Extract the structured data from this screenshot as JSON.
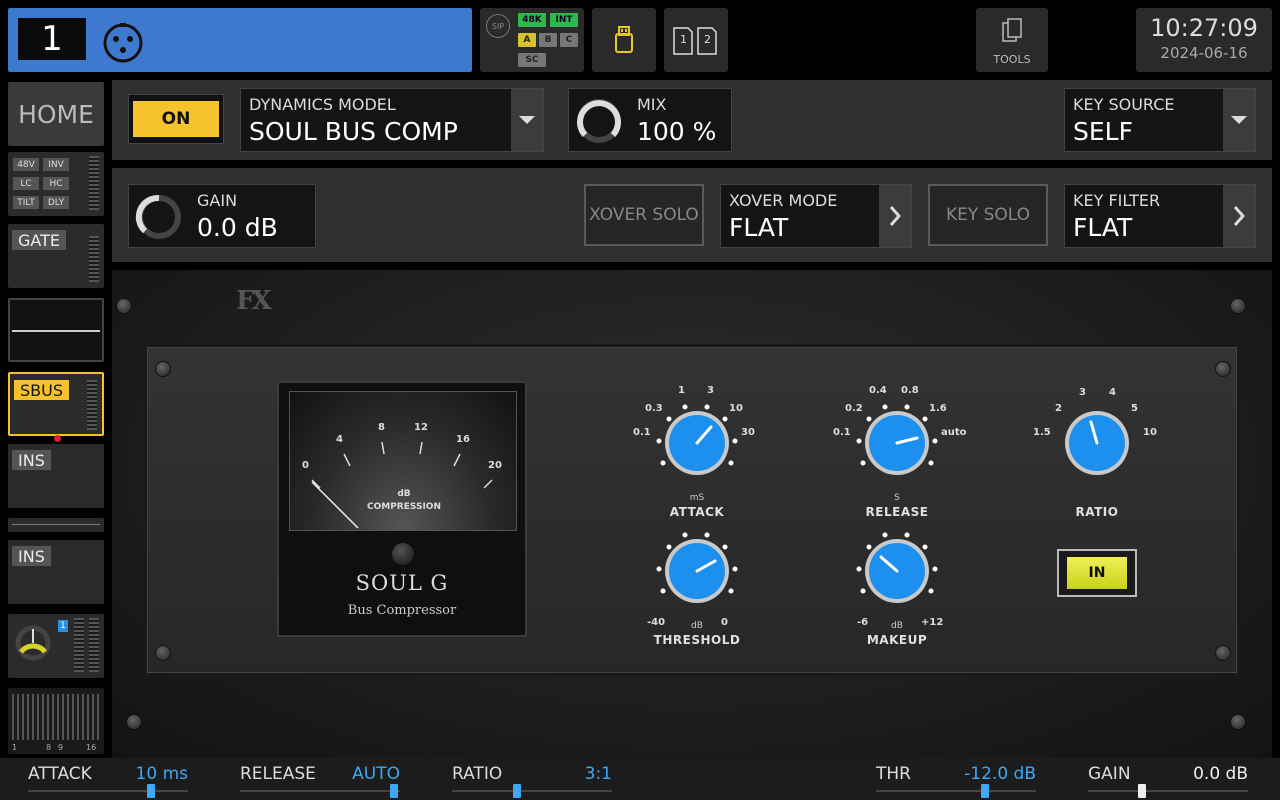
{
  "channel": {
    "number": "1",
    "icon": "xlr-connector-icon"
  },
  "status": {
    "sip": "SIP",
    "badges": {
      "rate": "48K",
      "clock": "INT",
      "a": "A",
      "b": "B",
      "c": "C",
      "sc": "SC"
    },
    "usb_icon": "usb-drive-icon",
    "sd_cards": [
      "1",
      "2"
    ],
    "tools_label": "TOOLS"
  },
  "clock": {
    "time": "10:27:09",
    "date": "2024-06-16"
  },
  "left_strip": {
    "home": "HOME",
    "input_buttons": [
      "48V",
      "INV",
      "LC",
      "HC",
      "TILT",
      "DLY"
    ],
    "gate": "GATE",
    "sbus": "SBUS",
    "ins1": "INS",
    "ins2": "INS",
    "bus_badge": "1",
    "meter_scale": {
      "start": "1",
      "mid1": "8",
      "mid2": "9",
      "end": "16"
    }
  },
  "row1": {
    "on_label": "ON",
    "dynamics_model_label": "DYNAMICS MODEL",
    "dynamics_model_value": "SOUL BUS COMP",
    "mix_label": "MIX",
    "mix_value": "100 %",
    "key_source_label": "KEY SOURCE",
    "key_source_value": "SELF"
  },
  "row2": {
    "gain_label": "GAIN",
    "gain_value": "0.0 dB",
    "xover_solo": "XOVER SOLO",
    "xover_mode_label": "XOVER MODE",
    "xover_mode_value": "FLAT",
    "key_solo": "KEY SOLO",
    "key_filter_label": "KEY FILTER",
    "key_filter_value": "FLAT"
  },
  "plugin": {
    "logo": "FX",
    "meter": {
      "scale": [
        "0",
        "4",
        "8",
        "12",
        "16",
        "20"
      ],
      "unit": "dB",
      "caption": "COMPRESSION",
      "brand": "SOUL G",
      "subtitle": "Bus Compressor"
    },
    "attack": {
      "label": "ATTACK",
      "unit": "mS",
      "scale": [
        "0.1",
        "0.3",
        "1",
        "3",
        "10",
        "30"
      ]
    },
    "release": {
      "label": "RELEASE",
      "unit": "S",
      "scale": [
        "0.1",
        "0.2",
        "0.4",
        "0.8",
        "1.6",
        "auto"
      ]
    },
    "ratio": {
      "label": "RATIO",
      "scale": [
        "1.5",
        "2",
        "3",
        "4",
        "5",
        "10"
      ]
    },
    "threshold": {
      "label": "THRESHOLD",
      "unit": "dB",
      "min": "-40",
      "max": "0"
    },
    "makeup": {
      "label": "MAKEUP",
      "unit": "dB",
      "min": "-6",
      "max": "+12"
    },
    "in_button": "IN"
  },
  "bottom": {
    "attack": {
      "name": "ATTACK",
      "value": "10 ms",
      "level": 0.78
    },
    "release": {
      "name": "RELEASE",
      "value": "AUTO",
      "level": 0.99
    },
    "ratio": {
      "name": "RATIO",
      "value": "3:1",
      "level": 0.4
    },
    "thr": {
      "name": "THR",
      "value": "-12.0 dB",
      "level": 0.69
    },
    "gain": {
      "name": "GAIN",
      "value": "0.0 dB",
      "level": 0.33
    }
  },
  "colors": {
    "accent_blue": "#3da8f3",
    "channel_blue": "#3f79cf",
    "on_yellow": "#f6c22d",
    "in_green": "#e4ec3a"
  }
}
